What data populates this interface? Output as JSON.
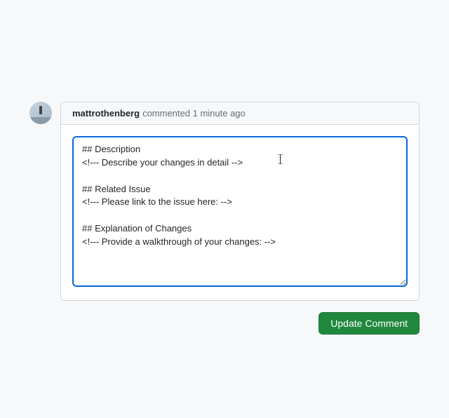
{
  "comment": {
    "username": "mattrothenberg",
    "action_text": "commented",
    "timestamp": "1 minute ago",
    "body": "## Description\n<!--- Describe your changes in detail -->\n\n## Related Issue\n<!--- Please link to the issue here: -->\n\n## Explanation of Changes\n<!--- Provide a walkthrough of your changes: -->"
  },
  "actions": {
    "update_label": "Update Comment"
  }
}
